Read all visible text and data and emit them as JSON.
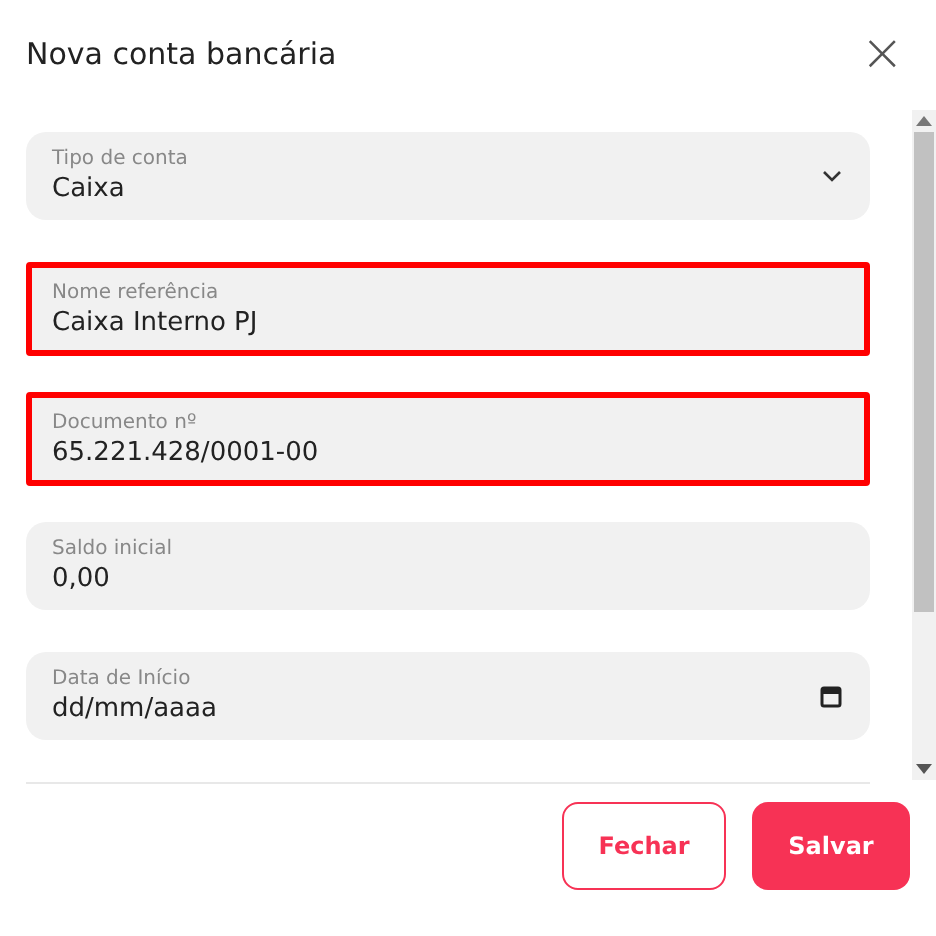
{
  "dialog": {
    "title": "Nova conta bancária",
    "close": "×"
  },
  "fields": [
    {
      "kind": "select",
      "label": "Tipo de conta",
      "value": "Caixa",
      "error": false
    },
    {
      "kind": "text",
      "label": "Nome referência",
      "value": "Caixa Interno PJ",
      "error": true
    },
    {
      "kind": "text",
      "label": "Documento nº",
      "value": "65.221.428/0001-00",
      "error": true
    },
    {
      "kind": "text",
      "label": "Saldo inicial",
      "value": "0,00",
      "error": false
    },
    {
      "kind": "date",
      "label": "Data de Início",
      "placeholder": "dd/mm/aaaa",
      "error": false
    }
  ],
  "buttons": [
    {
      "kind": "secondary",
      "label": "Fechar"
    },
    {
      "kind": "primary",
      "label": "Salvar"
    }
  ]
}
